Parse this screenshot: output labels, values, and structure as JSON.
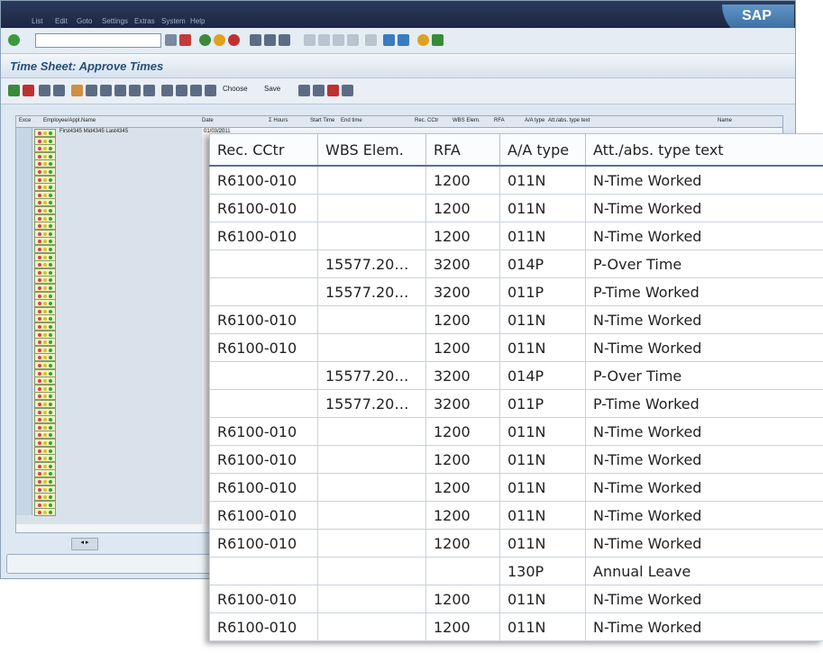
{
  "app": {
    "logo_text": "SAP"
  },
  "menu": [
    "List",
    "Edit",
    "Goto",
    "Settings",
    "Extras",
    "System",
    "Help"
  ],
  "title": "Time Sheet: Approve Times",
  "toolbar2": {
    "choose_label": "Choose",
    "save_label": "Save"
  },
  "background_table": {
    "headers": [
      "Exce",
      "Employee/Appl.Name",
      "Date",
      "Σ Hours",
      "Start Time",
      "End time",
      "Rec. CCtr",
      "WBS Elem.",
      "RFA",
      "A/A type",
      "Att./abs. type text",
      "Name"
    ],
    "employee_name": "First4345 Mid4345 Last4345",
    "first_date": "01/03/2011"
  },
  "zoom_table": {
    "headers": [
      "Rec. CCtr",
      "WBS Elem.",
      "RFA",
      "A/A type",
      "Att./abs. type text"
    ],
    "rows": [
      [
        "R6100-010",
        "",
        "1200",
        "011N",
        "N-Time Worked"
      ],
      [
        "R6100-010",
        "",
        "1200",
        "011N",
        "N-Time Worked"
      ],
      [
        "R6100-010",
        "",
        "1200",
        "011N",
        "N-Time Worked"
      ],
      [
        "",
        "15577.20",
        "3200",
        "014P",
        "P-Over Time"
      ],
      [
        "",
        "15577.20",
        "3200",
        "011P",
        "P-Time Worked"
      ],
      [
        "R6100-010",
        "",
        "1200",
        "011N",
        "N-Time Worked"
      ],
      [
        "R6100-010",
        "",
        "1200",
        "011N",
        "N-Time Worked"
      ],
      [
        "",
        "15577.20",
        "3200",
        "014P",
        "P-Over Time"
      ],
      [
        "",
        "15577.20",
        "3200",
        "011P",
        "P-Time Worked"
      ],
      [
        "R6100-010",
        "",
        "1200",
        "011N",
        "N-Time Worked"
      ],
      [
        "R6100-010",
        "",
        "1200",
        "011N",
        "N-Time Worked"
      ],
      [
        "R6100-010",
        "",
        "1200",
        "011N",
        "N-Time Worked"
      ],
      [
        "R6100-010",
        "",
        "1200",
        "011N",
        "N-Time Worked"
      ],
      [
        "R6100-010",
        "",
        "1200",
        "011N",
        "N-Time Worked"
      ],
      [
        "",
        "",
        "",
        "130P",
        "Annual Leave"
      ],
      [
        "R6100-010",
        "",
        "1200",
        "011N",
        "N-Time Worked"
      ],
      [
        "R6100-010",
        "",
        "1200",
        "011N",
        "N-Time Worked"
      ]
    ]
  },
  "colors": {
    "title": "#274e78",
    "menubar": "#1c2644",
    "traffic_green": "#2fa32f",
    "traffic_yellow": "#e0c020",
    "traffic_red": "#d03030"
  }
}
